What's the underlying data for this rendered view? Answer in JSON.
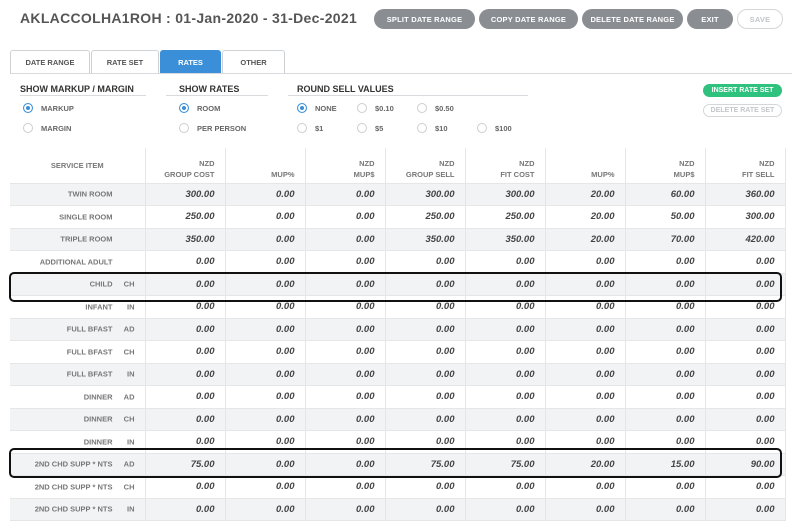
{
  "header": {
    "title": "AKLACCOLHA1ROH : 01-Jan-2020 - 31-Dec-2021"
  },
  "toolbar": {
    "split_label": "SPLIT DATE RANGE",
    "copy_label": "COPY DATE RANGE",
    "delete_label": "DELETE DATE RANGE",
    "exit_label": "EXIT",
    "save_label": "SAVE"
  },
  "tabs": [
    {
      "label": "DATE RANGE",
      "active": false
    },
    {
      "label": "RATE SET",
      "active": false
    },
    {
      "label": "RATES",
      "active": true
    },
    {
      "label": "OTHER",
      "active": false
    }
  ],
  "markup_section": {
    "title": "SHOW MARKUP / MARGIN",
    "options": [
      {
        "label": "MARKUP",
        "selected": true
      },
      {
        "label": "MARGIN",
        "selected": false
      }
    ]
  },
  "rates_section": {
    "title": "SHOW RATES",
    "options": [
      {
        "label": "ROOM",
        "selected": true
      },
      {
        "label": "PER PERSON",
        "selected": false
      }
    ]
  },
  "round_section": {
    "title": "ROUND SELL VALUES",
    "options": [
      {
        "label": "NONE",
        "selected": true
      },
      {
        "label": "$0.10",
        "selected": false
      },
      {
        "label": "$0.50",
        "selected": false
      },
      {
        "label": "$1",
        "selected": false
      },
      {
        "label": "$5",
        "selected": false
      },
      {
        "label": "$10",
        "selected": false
      },
      {
        "label": "$100",
        "selected": false
      }
    ]
  },
  "side_buttons": {
    "insert_label": "INSERT RATE SET",
    "delete_label": "DELETE RATE SET"
  },
  "table": {
    "service_header": "SERVICE ITEM",
    "columns": [
      {
        "line1": "NZD",
        "line2": "GROUP COST"
      },
      {
        "line1": "",
        "line2": "MUP%"
      },
      {
        "line1": "NZD",
        "line2": "MUP$"
      },
      {
        "line1": "NZD",
        "line2": "GROUP SELL"
      },
      {
        "line1": "NZD",
        "line2": "FIT COST"
      },
      {
        "line1": "",
        "line2": "MUP%"
      },
      {
        "line1": "NZD",
        "line2": "MUP$"
      },
      {
        "line1": "NZD",
        "line2": "FIT SELL"
      }
    ],
    "rows": [
      {
        "name": "TWIN ROOM",
        "age": "",
        "values": [
          "300.00",
          "0.00",
          "0.00",
          "300.00",
          "300.00",
          "20.00",
          "60.00",
          "360.00"
        ]
      },
      {
        "name": "SINGLE ROOM",
        "age": "",
        "values": [
          "250.00",
          "0.00",
          "0.00",
          "250.00",
          "250.00",
          "20.00",
          "50.00",
          "300.00"
        ]
      },
      {
        "name": "TRIPLE ROOM",
        "age": "",
        "values": [
          "350.00",
          "0.00",
          "0.00",
          "350.00",
          "350.00",
          "20.00",
          "70.00",
          "420.00"
        ]
      },
      {
        "name": "ADDITIONAL ADULT",
        "age": "",
        "values": [
          "0.00",
          "0.00",
          "0.00",
          "0.00",
          "0.00",
          "0.00",
          "0.00",
          "0.00"
        ]
      },
      {
        "name": "CHILD",
        "age": "CH",
        "values": [
          "0.00",
          "0.00",
          "0.00",
          "0.00",
          "0.00",
          "0.00",
          "0.00",
          "0.00"
        ]
      },
      {
        "name": "INFANT",
        "age": "IN",
        "values": [
          "0.00",
          "0.00",
          "0.00",
          "0.00",
          "0.00",
          "0.00",
          "0.00",
          "0.00"
        ]
      },
      {
        "name": "FULL BFAST",
        "age": "AD",
        "values": [
          "0.00",
          "0.00",
          "0.00",
          "0.00",
          "0.00",
          "0.00",
          "0.00",
          "0.00"
        ]
      },
      {
        "name": "FULL BFAST",
        "age": "CH",
        "values": [
          "0.00",
          "0.00",
          "0.00",
          "0.00",
          "0.00",
          "0.00",
          "0.00",
          "0.00"
        ]
      },
      {
        "name": "FULL BFAST",
        "age": "IN",
        "values": [
          "0.00",
          "0.00",
          "0.00",
          "0.00",
          "0.00",
          "0.00",
          "0.00",
          "0.00"
        ]
      },
      {
        "name": "DINNER",
        "age": "AD",
        "values": [
          "0.00",
          "0.00",
          "0.00",
          "0.00",
          "0.00",
          "0.00",
          "0.00",
          "0.00"
        ]
      },
      {
        "name": "DINNER",
        "age": "CH",
        "values": [
          "0.00",
          "0.00",
          "0.00",
          "0.00",
          "0.00",
          "0.00",
          "0.00",
          "0.00"
        ]
      },
      {
        "name": "DINNER",
        "age": "IN",
        "values": [
          "0.00",
          "0.00",
          "0.00",
          "0.00",
          "0.00",
          "0.00",
          "0.00",
          "0.00"
        ]
      },
      {
        "name": "2ND CHD SUPP * NTS",
        "age": "AD",
        "values": [
          "75.00",
          "0.00",
          "0.00",
          "75.00",
          "75.00",
          "20.00",
          "15.00",
          "90.00"
        ]
      },
      {
        "name": "2ND CHD SUPP * NTS",
        "age": "CH",
        "values": [
          "0.00",
          "0.00",
          "0.00",
          "0.00",
          "0.00",
          "0.00",
          "0.00",
          "0.00"
        ]
      },
      {
        "name": "2ND CHD SUPP * NTS",
        "age": "IN",
        "values": [
          "0.00",
          "0.00",
          "0.00",
          "0.00",
          "0.00",
          "0.00",
          "0.00",
          "0.00"
        ]
      }
    ]
  }
}
